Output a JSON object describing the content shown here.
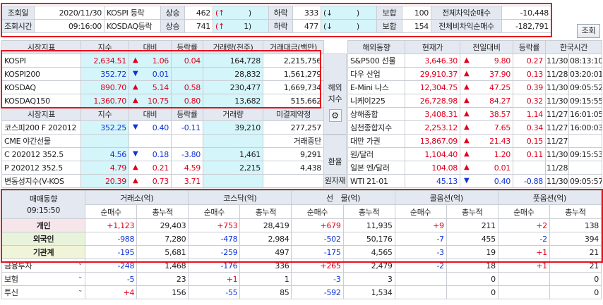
{
  "top": {
    "date_label": "조회일",
    "date_value": "2020/11/30",
    "time_label": "조회시간",
    "time_value": "09:16:00",
    "rows": [
      {
        "name": "KOSPI 등락",
        "up_label": "상승",
        "up": "462",
        "up_sym": "(↑",
        "up_val": "",
        "up_close": ")",
        "dn_label": "하락",
        "dn": "333",
        "dn_sym": "(↓",
        "dn_val": "",
        "dn_close": ")",
        "flat_label": "보합",
        "flat": "100",
        "arb_label": "전체차익순매수",
        "arb": "-10,448"
      },
      {
        "name": "KOSDAQ등락",
        "up_label": "상승",
        "up": "741",
        "up_sym": "(↑",
        "up_val": "1",
        "up_close": ")",
        "dn_label": "하락",
        "dn": "477",
        "dn_sym": "(↓",
        "dn_val": "",
        "dn_close": ")",
        "flat_label": "보합",
        "flat": "154",
        "arb_label": "전체비차익순매수",
        "arb": "-182,791"
      }
    ],
    "query_button": "조회"
  },
  "market": {
    "headers": [
      "시장지표",
      "지수",
      "대비",
      "등락률",
      "거래량(천주)",
      "거래대금(백만)"
    ],
    "rows": [
      {
        "name": "KOSPI",
        "idx": "2,634.51",
        "dir": "▲",
        "chg": "1.06",
        "rate": "0.04",
        "vol": "164,728",
        "amt": "2,215,756",
        "cls": "red"
      },
      {
        "name": "KOSPI200",
        "idx": "352.72",
        "dir": "▼",
        "chg": "0.01",
        "rate": "",
        "vol": "28,832",
        "amt": "1,561,279",
        "cls": "blue"
      },
      {
        "name": "KOSDAQ",
        "idx": "890.70",
        "dir": "▲",
        "chg": "5.14",
        "rate": "0.58",
        "vol": "230,477",
        "amt": "1,669,734",
        "cls": "red"
      },
      {
        "name": "KOSDAQ150",
        "idx": "1,360.70",
        "dir": "▲",
        "chg": "10.75",
        "rate": "0.80",
        "vol": "13,682",
        "amt": "515,662",
        "cls": "red"
      }
    ],
    "headers2": [
      "시장지표",
      "지수",
      "대비",
      "등락률",
      "거래량",
      "미결제약정"
    ],
    "rows2": [
      {
        "name": "코스피200 F 202012",
        "idx": "352.25",
        "dir": "▼",
        "chg": "0.40",
        "rate": "-0.11",
        "vol": "39,210",
        "amt": "277,257",
        "cls": "blue"
      },
      {
        "name": "CME 야간선물",
        "idx": "",
        "dir": "",
        "chg": "",
        "rate": "",
        "vol": "",
        "amt": "거래중단",
        "cls": ""
      },
      {
        "name": "C 202012 352.5",
        "idx": "4.56",
        "dir": "▼",
        "chg": "0.18",
        "rate": "-3.80",
        "vol": "1,461",
        "amt": "9,291",
        "cls": "blue"
      },
      {
        "name": "P 202012 352.5",
        "idx": "4.79",
        "dir": "▲",
        "chg": "0.21",
        "rate": "4.59",
        "vol": "2,215",
        "amt": "4,438",
        "cls": "red"
      },
      {
        "name": "변동성지수(V-KOS",
        "idx": "20.39",
        "dir": "▲",
        "chg": "0.73",
        "rate": "3.71",
        "vol": "",
        "amt": "",
        "cls": "red"
      }
    ]
  },
  "side": {
    "overseas_label": "해외지수",
    "exchange_label": "환율",
    "raw_label": "원자재"
  },
  "overseas": {
    "headers": [
      "해외동향",
      "현재가",
      "전일대비",
      "등락률",
      "한국시간"
    ],
    "rows": [
      {
        "name": "S&P500 선물",
        "price": "3,646.30",
        "dir": "▲",
        "chg": "9.80",
        "rate": "0.27",
        "date": "11/30",
        "time": "08:13:10",
        "cls": "red"
      },
      {
        "name": "다우 산업",
        "price": "29,910.37",
        "dir": "▲",
        "chg": "37.90",
        "rate": "0.13",
        "date": "11/28",
        "time": "03:20:01",
        "cls": "red"
      },
      {
        "name": "E-Mini 나스",
        "price": "12,304.75",
        "dir": "▲",
        "chg": "47.25",
        "rate": "0.39",
        "date": "11/30",
        "time": "09:05:52",
        "cls": "red"
      },
      {
        "name": "니케이225",
        "price": "26,728.98",
        "dir": "▲",
        "chg": "84.27",
        "rate": "0.32",
        "date": "11/30",
        "time": "09:15:55",
        "cls": "red"
      },
      {
        "name": "상해종합",
        "price": "3,408.31",
        "dir": "▲",
        "chg": "38.57",
        "rate": "1.14",
        "date": "11/27",
        "time": "16:01:05",
        "cls": "red"
      },
      {
        "name": "심천종합지수",
        "price": "2,253.12",
        "dir": "▲",
        "chg": "7.65",
        "rate": "0.34",
        "date": "11/27",
        "time": "16:00:03",
        "cls": "red"
      },
      {
        "name": "대만 가권",
        "price": "13,867.09",
        "dir": "▲",
        "chg": "21.43",
        "rate": "0.15",
        "date": "11/27",
        "time": "",
        "cls": "red"
      },
      {
        "name": "원/달러",
        "price": "1,104.40",
        "dir": "▲",
        "chg": "1.20",
        "rate": "0.11",
        "date": "11/30",
        "time": "09:15:53",
        "cls": "red"
      },
      {
        "name": "일본 엔/달러",
        "price": "104.08",
        "dir": "▲",
        "chg": "0.01",
        "rate": "",
        "date": "11/28",
        "time": "",
        "cls": "red"
      },
      {
        "name": "WTI 21-01",
        "price": "45.13",
        "dir": "▼",
        "chg": "0.40",
        "rate": "-0.88",
        "date": "11/30",
        "time": "09:05:57",
        "cls": "blue"
      }
    ]
  },
  "trend": {
    "title": "매매동향",
    "time": "09:15:50",
    "groups": [
      "거래소(억)",
      "코스닥(억)",
      "선　물(억)",
      "콜옵션(억)",
      "풋옵션(억)"
    ],
    "sub": [
      "순매수",
      "총누적"
    ],
    "rows": [
      {
        "name": "개인",
        "vals": [
          "+1,123",
          "29,403",
          "+753",
          "28,419",
          "+679",
          "11,935",
          "+9",
          "211",
          "+2",
          "138"
        ],
        "cls": [
          "red",
          "",
          "red",
          "",
          "red",
          "",
          "red",
          "",
          "red",
          ""
        ]
      },
      {
        "name": "외국인",
        "vals": [
          "-988",
          "7,280",
          "-478",
          "2,984",
          "-502",
          "50,176",
          "-7",
          "455",
          "-2",
          "394"
        ],
        "cls": [
          "blue",
          "",
          "blue",
          "",
          "blue",
          "",
          "blue",
          "",
          "blue",
          ""
        ]
      },
      {
        "name": "기관계",
        "vals": [
          "-195",
          "5,681",
          "-259",
          "497",
          "-175",
          "4,565",
          "-3",
          "19",
          "+1",
          "21"
        ],
        "cls": [
          "blue",
          "",
          "blue",
          "",
          "blue",
          "",
          "blue",
          "",
          "red",
          ""
        ]
      },
      {
        "name": "금융투자",
        "vals": [
          "-248",
          "1,468",
          "-176",
          "336",
          "+265",
          "2,479",
          "-2",
          "18",
          "+1",
          "21"
        ],
        "cls": [
          "blue",
          "",
          "blue",
          "",
          "red",
          "",
          "blue",
          "",
          "red",
          ""
        ]
      },
      {
        "name": "보험",
        "vals": [
          "-5",
          "23",
          "+1",
          "1",
          "-3",
          "3",
          "",
          "0",
          "",
          "0"
        ],
        "cls": [
          "blue",
          "",
          "red",
          "",
          "blue",
          "",
          "",
          "",
          "",
          ""
        ]
      },
      {
        "name": "투신",
        "vals": [
          "+4",
          "156",
          "-55",
          "85",
          "-592",
          "1,534",
          "",
          "0",
          "",
          "0"
        ],
        "cls": [
          "red",
          "",
          "blue",
          "",
          "blue",
          "",
          "",
          "",
          "",
          ""
        ]
      }
    ]
  }
}
